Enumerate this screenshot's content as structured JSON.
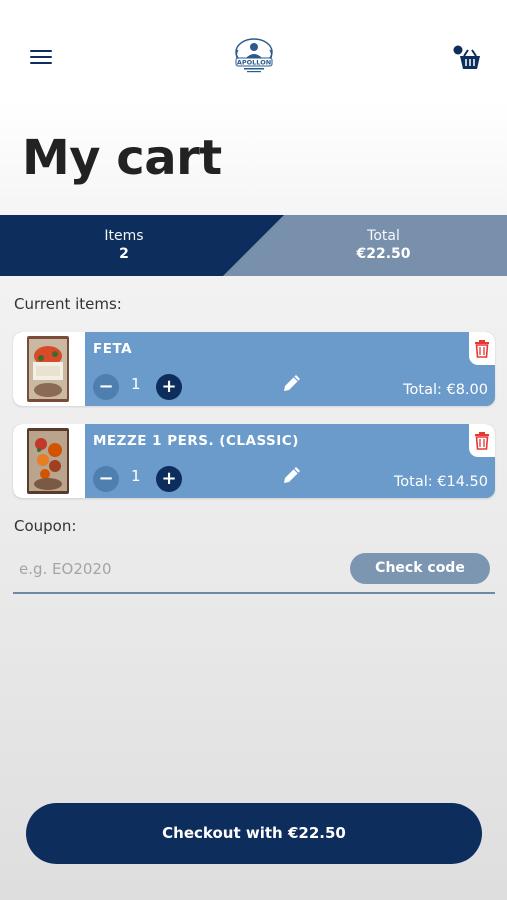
{
  "header": {
    "menu_icon": "hamburger-menu-icon",
    "logo_text": "APOLLON",
    "cart_icon": "basket-icon"
  },
  "page_title": "My cart",
  "summary": {
    "items_label": "Items",
    "items_value": "2",
    "total_label": "Total",
    "total_value": "€22.50",
    "colors": {
      "items_bg": "#0d2d5c",
      "total_bg": "#7890ab"
    }
  },
  "current_items_label": "Current items:",
  "items": [
    {
      "name": "FETA",
      "quantity": "1",
      "minus": "−",
      "plus": "+",
      "total": "Total: €8.00"
    },
    {
      "name": "MEZZE 1 PERS. (CLASSIC)",
      "quantity": "1",
      "minus": "−",
      "plus": "+",
      "total": "Total: €14.50"
    }
  ],
  "coupon": {
    "label": "Coupon:",
    "placeholder": "e.g. EO2020",
    "check_button": "Check code"
  },
  "checkout_button": "Checkout with €22.50",
  "colors": {
    "accent": "#0d2d5c",
    "card": "#6b9bcb",
    "delete": "#e53935"
  }
}
